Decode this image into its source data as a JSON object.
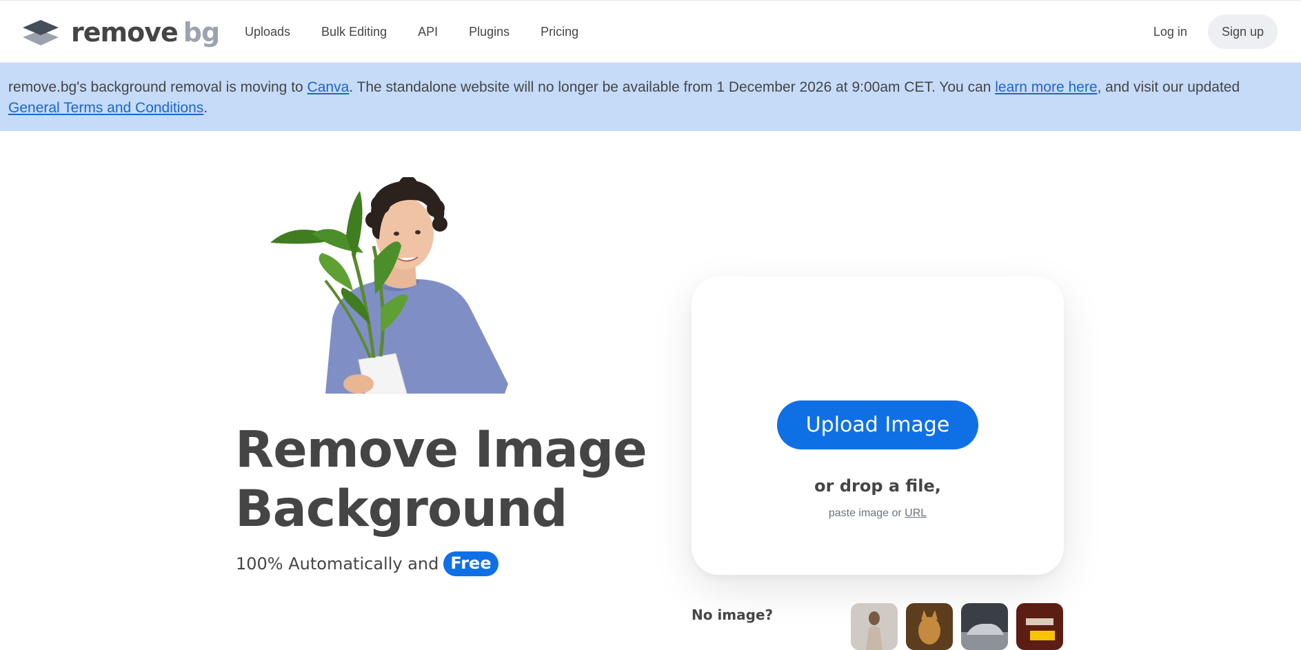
{
  "navbar": {
    "logo": {
      "text_main": "remove",
      "text_accent": "bg"
    },
    "links": [
      "Uploads",
      "Bulk Editing",
      "API",
      "Plugins",
      "Pricing"
    ],
    "login_label": "Log in",
    "signup_label": "Sign up"
  },
  "notice": {
    "text_1": "remove.bg's background removal is moving to ",
    "link_canva": "Canva",
    "text_2": ". The standalone website will no longer be available from 1 December 2026 at 9:00am CET. You can ",
    "link_learn": "learn more here",
    "text_3": ", and visit our updated ",
    "link_terms": "General Terms and Conditions",
    "text_4": "."
  },
  "hero": {
    "title_line1": "Remove Image",
    "title_line2": "Background",
    "subtitle": "100% Automatically and",
    "free_badge": "Free"
  },
  "upload": {
    "button_label": "Upload Image",
    "drop_text": "or drop a file,",
    "paste_text": "paste image or",
    "url_link": "URL"
  },
  "samples": {
    "no_image_label": "No image?"
  },
  "colors": {
    "accent": "#0f70e6",
    "banner": "#c5dbf8",
    "link": "#1d66c7",
    "text": "#454545"
  },
  "icons": {
    "logo": "layered-diamond-logo-icon"
  }
}
